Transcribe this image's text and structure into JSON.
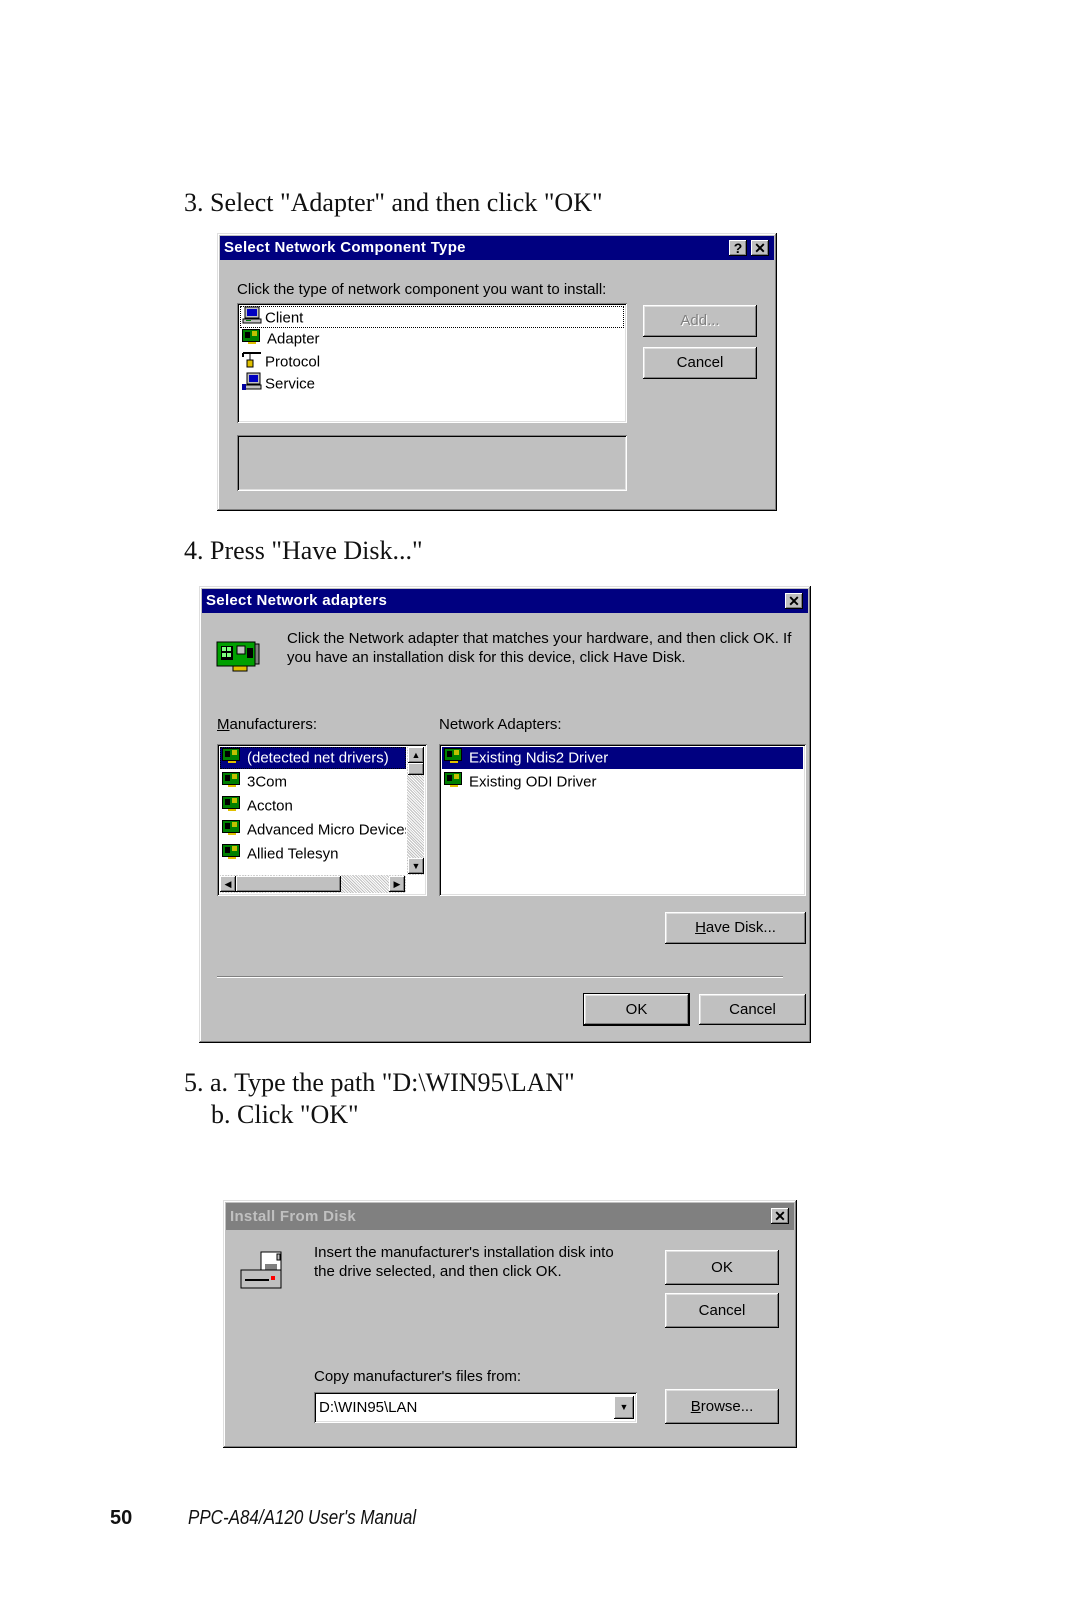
{
  "steps": {
    "step3": "3. Select \"Adapter\" and then click \"OK\"",
    "step4": "4. Press \"Have Disk...\"",
    "step5a": "5. a. Type the path \"D:\\WIN95\\LAN\"",
    "step5b": "b. Click \"OK\""
  },
  "dialog1": {
    "title": "Select Network Component Type",
    "help_button": "?",
    "close_button": "✕",
    "prompt": "Click the type of network component you want to install:",
    "items": [
      {
        "label": "Client",
        "icon": "computer-icon"
      },
      {
        "label": "Adapter",
        "icon": "network-card-icon"
      },
      {
        "label": "Protocol",
        "icon": "protocol-icon"
      },
      {
        "label": "Service",
        "icon": "service-icon"
      }
    ],
    "add_button": "Add...",
    "cancel_button": "Cancel",
    "description": ""
  },
  "dialog2": {
    "title": "Select Network adapters",
    "close_button": "✕",
    "instructions_line1": "Click the Network adapter that matches your hardware, and then click OK. If",
    "instructions_line2": "you have an installation disk for this device, click Have Disk.",
    "manufacturers_label": "Manufacturers:",
    "manufacturers": [
      "(detected net drivers)",
      "3Com",
      "Accton",
      "Advanced Micro Devices",
      "Allied Telesyn"
    ],
    "adapters_label": "Network Adapters:",
    "adapters": [
      "Existing Ndis2 Driver",
      "Existing ODI Driver"
    ],
    "have_disk_button": "Have Disk...",
    "ok_button": "OK",
    "cancel_button": "Cancel"
  },
  "dialog3": {
    "title": "Install From Disk",
    "close_button": "✕",
    "message_line1": "Insert the manufacturer's installation disk into",
    "message_line2": "the drive selected, and then click OK.",
    "ok_button": "OK",
    "cancel_button": "Cancel",
    "copy_label": "Copy manufacturer's files from:",
    "path_value": "D:\\WIN95\\LAN",
    "browse_button": "Browse..."
  },
  "footer": {
    "page_number": "50",
    "manual_title": "PPC-A84/A120 User's Manual"
  },
  "colors": {
    "title_active": "#000080",
    "title_inactive": "#808080",
    "dialog_face": "#c0c0c0",
    "selection": "#000080"
  }
}
